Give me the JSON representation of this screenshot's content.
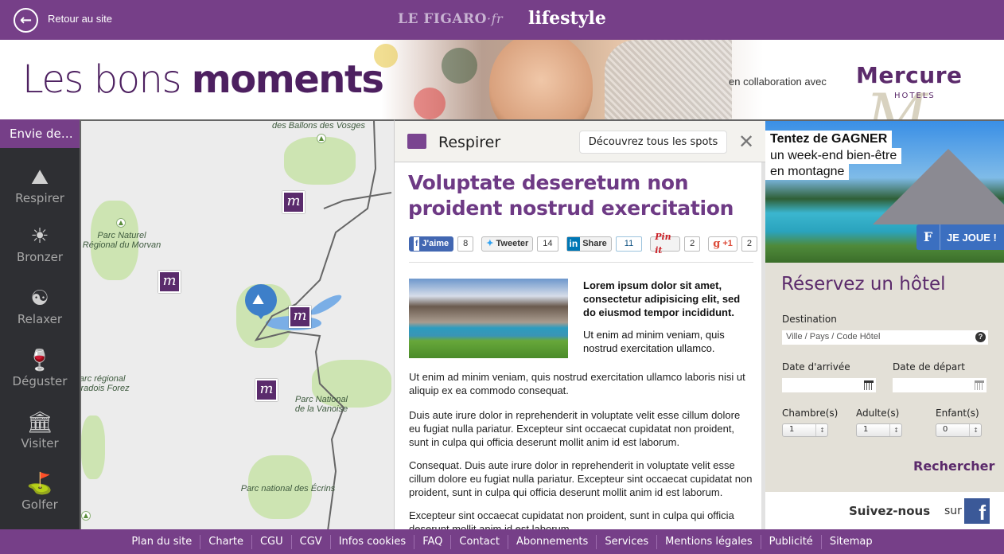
{
  "topbar": {
    "back_label": "Retour au site",
    "brand_figaro": "LE FIGARO",
    "brand_fr": "·fr",
    "brand_section": "lifestyle",
    "color": "#763f88"
  },
  "banner": {
    "headline_light": "Les bons ",
    "headline_bold": "moments",
    "collab_text": "en collaboration avec",
    "partner_name": "Mercure",
    "partner_sub": "HOTELS"
  },
  "sidebar": {
    "title": "Envie de…",
    "items": [
      {
        "label": "Respirer",
        "icon": "landscape-icon"
      },
      {
        "label": "Bronzer",
        "icon": "sun-icon"
      },
      {
        "label": "Relaxer",
        "icon": "yin-yang-icon"
      },
      {
        "label": "Déguster",
        "icon": "wine-glass-icon"
      },
      {
        "label": "Visiter",
        "icon": "museum-icon"
      },
      {
        "label": "Golfer",
        "icon": "golf-icon"
      }
    ]
  },
  "map": {
    "labels": [
      "des Ballons des Vosges",
      "Parc Naturel\nRégional du Morvan",
      "Parc régional\nLivradois Forez",
      "Parc National\nde la Vanoise",
      "Parc national des Écrins"
    ]
  },
  "article": {
    "category": "Respirer",
    "discover_label": "Découvrez tous les spots",
    "title": "Voluptate deseretum non proident nostrud exercitation",
    "share": [
      {
        "label": "J'aime",
        "count": "8"
      },
      {
        "label": "Tweeter",
        "count": "14"
      },
      {
        "label": "Share",
        "count": "11"
      },
      {
        "label": "Pin it",
        "count": "2"
      },
      {
        "label": "+1",
        "count": "2"
      }
    ],
    "lead_bold": "Lorem ipsum dolor sit amet, consectetur adipisicing elit, sed do eiusmod tempor incididunt.",
    "lead_text": "Ut enim ad minim veniam, quis nostrud exercitation ullamco.",
    "paragraphs": [
      "Ut enim ad minim veniam, quis nostrud exercitation ullamco laboris nisi ut aliquip ex ea commodo consequat.",
      "Duis aute irure dolor in reprehenderit in voluptate velit esse cillum dolore eu fugiat nulla pariatur. Excepteur sint occaecat cupidatat non proident, sunt in culpa qui officia deserunt mollit anim id est laborum.",
      "Consequat. Duis aute irure dolor in reprehenderit in voluptate velit esse cillum dolore eu fugiat nulla pariatur. Excepteur sint occaecat cupidatat non proident, sunt in culpa qui officia deserunt mollit anim id est laborum.",
      "Excepteur sint occaecat cupidatat non proident, sunt in culpa qui officia deserunt mollit anim id est laborum."
    ]
  },
  "promo": {
    "line1": "Tentez de GAGNER",
    "line2": "un week-end bien-être",
    "line3": "en montagne",
    "cta": "JE JOUE !"
  },
  "booking": {
    "title": "Réservez un hôtel",
    "destination_label": "Destination",
    "destination_placeholder": "Ville / Pays / Code Hôtel",
    "arrival_label": "Date d'arrivée",
    "departure_label": "Date de départ",
    "rooms_label": "Chambre(s)",
    "rooms_value": "1",
    "adults_label": "Adulte(s)",
    "adults_value": "1",
    "children_label": "Enfant(s)",
    "children_value": "0",
    "search_label": "Rechercher"
  },
  "follow": {
    "text": "Suivez-nous",
    "sur": "sur"
  },
  "footer": {
    "links": [
      "Plan du site",
      "Charte",
      "CGU",
      "CGV",
      "Infos cookies",
      "FAQ",
      "Contact",
      "Abonnements",
      "Services",
      "Mentions légales",
      "Publicité",
      "Sitemap"
    ]
  }
}
